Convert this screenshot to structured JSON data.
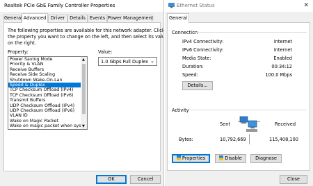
{
  "left_dialog": {
    "title": "Realtek PCIe GbE Family Controller Properties",
    "tabs": [
      "General",
      "Advanced",
      "Driver",
      "Details",
      "Events",
      "Power Management"
    ],
    "active_tab": "Advanced",
    "description": [
      "The following properties are available for this network adapter. Click",
      "the property you want to change on the left, and then select its value",
      "on the right."
    ],
    "property_label": "Property:",
    "value_label": "Value:",
    "properties": [
      "Power Saving Mode",
      "Priority & VLAN",
      "Receive Buffers",
      "Receive Side Scaling",
      "Shutdown Wake-On-Lan",
      "Speed & Duplex",
      "TCP Checksum Offload (IPv4)",
      "TCP Checksum Offload (IPv6)",
      "Transmit Buffers",
      "UDP Checksum Offload (IPv4)",
      "UDP Checksum Offload (IPv6)",
      "VLAN ID",
      "Wake on Magic Packet",
      "Wake on magic packet when syste"
    ],
    "selected_property": "Speed & Duplex",
    "value_selected": "1.0 Gbps Full Duplex",
    "ok_label": "OK",
    "cancel_label": "Cancel"
  },
  "right_dialog": {
    "title": "Ethernet Status",
    "tab": "General",
    "connection_label": "Connection",
    "rows": [
      {
        "label": "IPv4 Connectivity:",
        "value": "Internet"
      },
      {
        "label": "IPv6 Connectivity:",
        "value": "Internet"
      },
      {
        "label": "Media State:",
        "value": "Enabled"
      },
      {
        "label": "Duration:",
        "value": "00:34:12"
      },
      {
        "label": "Speed:",
        "value": "100.0 Mbps"
      }
    ],
    "details_label": "Details...",
    "activity_label": "Activity",
    "sent_label": "Sent",
    "received_label": "Received",
    "bytes_label": "Bytes:",
    "bytes_sent": "10,792,669",
    "bytes_received": "115,408,100",
    "properties_label": "Properties",
    "disable_label": "Disable",
    "diagnose_label": "Diagnose",
    "close_label": "Close"
  },
  "colors": {
    "selection": "#0078d7",
    "accent": "#0078d7"
  }
}
